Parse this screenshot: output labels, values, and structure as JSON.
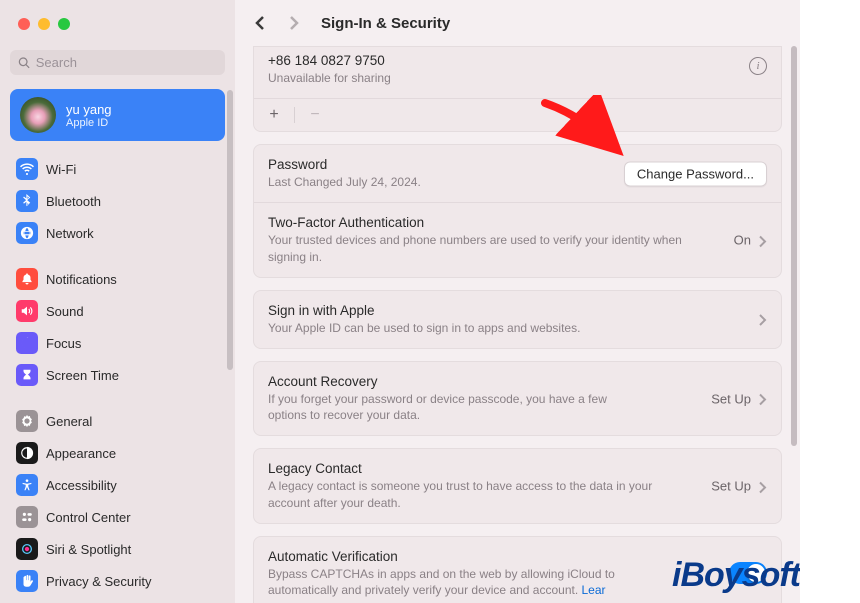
{
  "search": {
    "placeholder": "Search"
  },
  "account": {
    "name": "yu yang",
    "sub": "Apple ID"
  },
  "sidebar": {
    "items": [
      {
        "label": "Wi-Fi",
        "color": "#3a82f7"
      },
      {
        "label": "Bluetooth",
        "color": "#3a82f7"
      },
      {
        "label": "Network",
        "color": "#3a82f7"
      },
      {
        "label": "Notifications",
        "color": "#ff4d3d"
      },
      {
        "label": "Sound",
        "color": "#ff3b6b"
      },
      {
        "label": "Focus",
        "color": "#6a5af9"
      },
      {
        "label": "Screen Time",
        "color": "#6a5af9"
      },
      {
        "label": "General",
        "color": "#9b9396"
      },
      {
        "label": "Appearance",
        "color": "#1a1a1a"
      },
      {
        "label": "Accessibility",
        "color": "#3a82f7"
      },
      {
        "label": "Control Center",
        "color": "#9b9396"
      },
      {
        "label": "Siri & Spotlight",
        "color": "#1a1a1a"
      },
      {
        "label": "Privacy & Security",
        "color": "#3a82f7"
      }
    ]
  },
  "header": {
    "title": "Sign-In & Security"
  },
  "phone": {
    "number": "+86 184 0827 9750",
    "status": "Unavailable for sharing"
  },
  "password": {
    "title": "Password",
    "changed": "Last Changed July 24, 2024.",
    "button": "Change Password..."
  },
  "twofa": {
    "title": "Two-Factor Authentication",
    "desc": "Your trusted devices and phone numbers are used to verify your identity when signing in.",
    "value": "On"
  },
  "siwa": {
    "title": "Sign in with Apple",
    "desc": "Your Apple ID can be used to sign in to apps and websites."
  },
  "recovery": {
    "title": "Account Recovery",
    "desc": "If you forget your password or device passcode, you have a few options to recover your data.",
    "value": "Set Up"
  },
  "legacy": {
    "title": "Legacy Contact",
    "desc": "A legacy contact is someone you trust to have access to the data in your account after your death.",
    "value": "Set Up"
  },
  "autoverify": {
    "title": "Automatic Verification",
    "desc_a": "Bypass CAPTCHAs in apps and on the web by allowing iCloud to automatically and privately verify your device and account. ",
    "learn": "Lear"
  },
  "watermark": "iBoysoft"
}
